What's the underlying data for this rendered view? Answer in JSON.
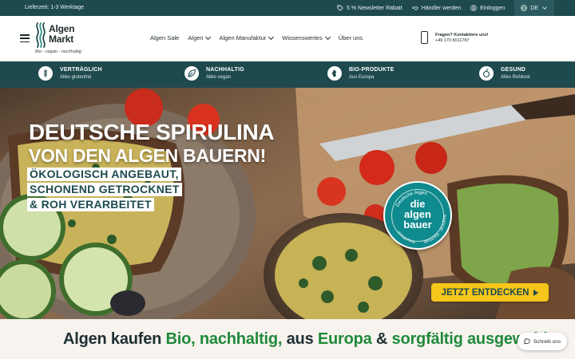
{
  "topbar": {
    "delivery": "Lieferzeit: 1-3 Werktage",
    "newsletter": "5 % Newsletter Rabatt",
    "dealers": "Händler werden",
    "login": "Einloggen",
    "language": "DE"
  },
  "header": {
    "logo_line1": "Algen",
    "logo_line2": "Markt",
    "logo_tagline": "Bio - vegan - nachhaltig",
    "nav": [
      "Algen Sale",
      "Algen",
      "Algen Manufaktur",
      "Wissenswertes",
      "Über uns"
    ],
    "contact_question": "Fragen? Kontaktiere uns!",
    "contact_phone": "+49 170 8011787",
    "icons": [
      "search-icon",
      "chat-icon",
      "basket-icon"
    ]
  },
  "usp": [
    {
      "title": "VERTRÄGLICH",
      "subtitle": "Alles glutenfrei",
      "icon": "wheat-icon"
    },
    {
      "title": "NACHHALTIG",
      "subtitle": "Alles vegan",
      "icon": "leaf-icon"
    },
    {
      "title": "BIO-PRODUKTE",
      "subtitle": "Aus Europa",
      "icon": "europe-icon"
    },
    {
      "title": "GESUND",
      "subtitle": "Alles Rohkost",
      "icon": "rawfood-icon"
    }
  ],
  "hero": {
    "title_line1": "DEUTSCHE SPIRULINA",
    "title_line2": "VON DEN ALGEN BAUERN!",
    "sub_line1": "ÖKOLOGISCH ANGEBAUT,",
    "sub_line2": "SCHONEND GETROCKNET",
    "sub_line3": "& ROH VERARBEITET",
    "badge_main_1": "die",
    "badge_main_2": "algen",
    "badge_main_3": "bauer",
    "badge_arc_top": "Deutsche Algen",
    "badge_arc_right": "Regional · Nachhaltig",
    "badge_arc_left": "Naturfrisch",
    "cta": "JETZT ENTDECKEN"
  },
  "bottom": {
    "part1": "Algen kaufen",
    "part2": "Bio,",
    "part3": "nachhaltig,",
    "part4": "aus",
    "part5": "Europa",
    "part6": "&",
    "part7": "sorgfältig ausgewählt"
  },
  "chat": {
    "label": "Schreib uns"
  },
  "colors": {
    "brand": "#1e4a4e",
    "accent": "#f6c61a",
    "green": "#1f8a3a"
  }
}
